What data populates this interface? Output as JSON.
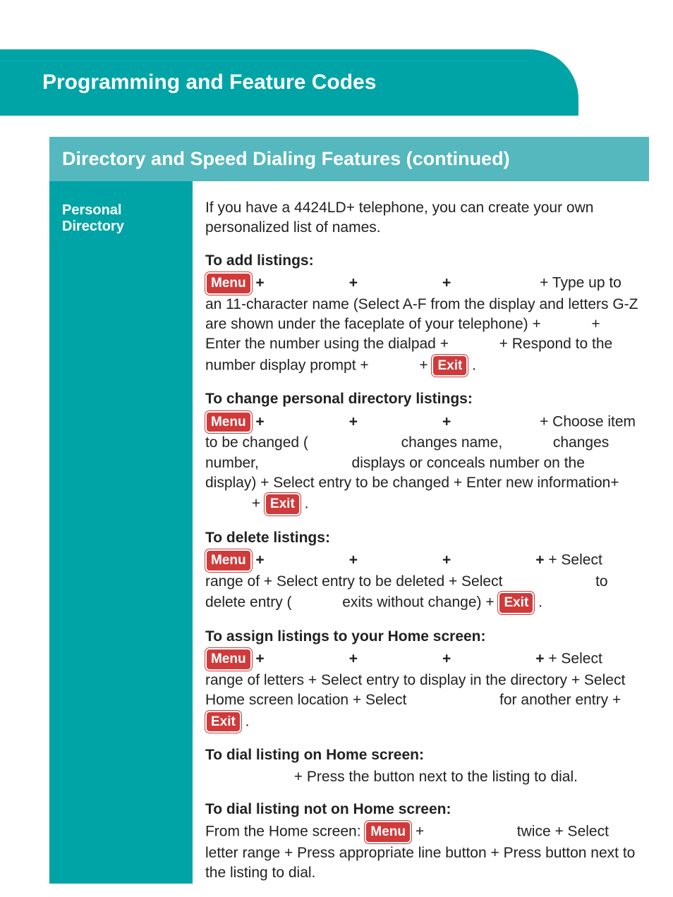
{
  "header": "Programming and Feature Codes",
  "section": "Directory and Speed Dialing Features (continued)",
  "sidebar": {
    "title": "Personal Directory"
  },
  "btn": {
    "menu": "Menu",
    "exit": "Exit"
  },
  "intro": "If you have a 4424LD+ telephone, you can create your own personalized list of names.",
  "add": {
    "heading": "To add listings:",
    "t1": " + Type up to an 11-character name (Select A-F from the display and letters G-Z are shown under the faceplate of your telephone) + ",
    "t2": " + Enter the number using the dialpad + ",
    "t3": " + Respond to the number display prompt + ",
    "t4": " + ",
    "t5": " ."
  },
  "change": {
    "heading": "To change personal directory listings:",
    "t1": " + Choose item to be changed ( ",
    "t2": " changes name, ",
    "t3": " changes number, ",
    "t4": " displays or conceals number on the display) + Select entry to be changed + Enter new information+ ",
    "t5": " + ",
    "t6": " ."
  },
  "delete": {
    "heading": "To delete listings:",
    "t1": " + Select range of + Select entry to be deleted + Select ",
    "t2": " to delete entry ( ",
    "t3": " exits without change) + ",
    "t4": " ."
  },
  "assign": {
    "heading": "To assign listings to your Home screen:",
    "t1": " + Select range of letters + Select entry to display in the directory + Select Home screen location + Select ",
    "t2": " for another entry + ",
    "t3": " ."
  },
  "dialHome": {
    "heading": "To dial listing on Home screen:",
    "t1": " + Press the button next to the listing to dial."
  },
  "dialNotHome": {
    "heading": "To dial listing not on Home screen:",
    "t1": "From the Home screen: ",
    "t2": " + ",
    "t3": " twice + Select letter range + Press appropriate line button + Press button next to the listing to dial."
  }
}
